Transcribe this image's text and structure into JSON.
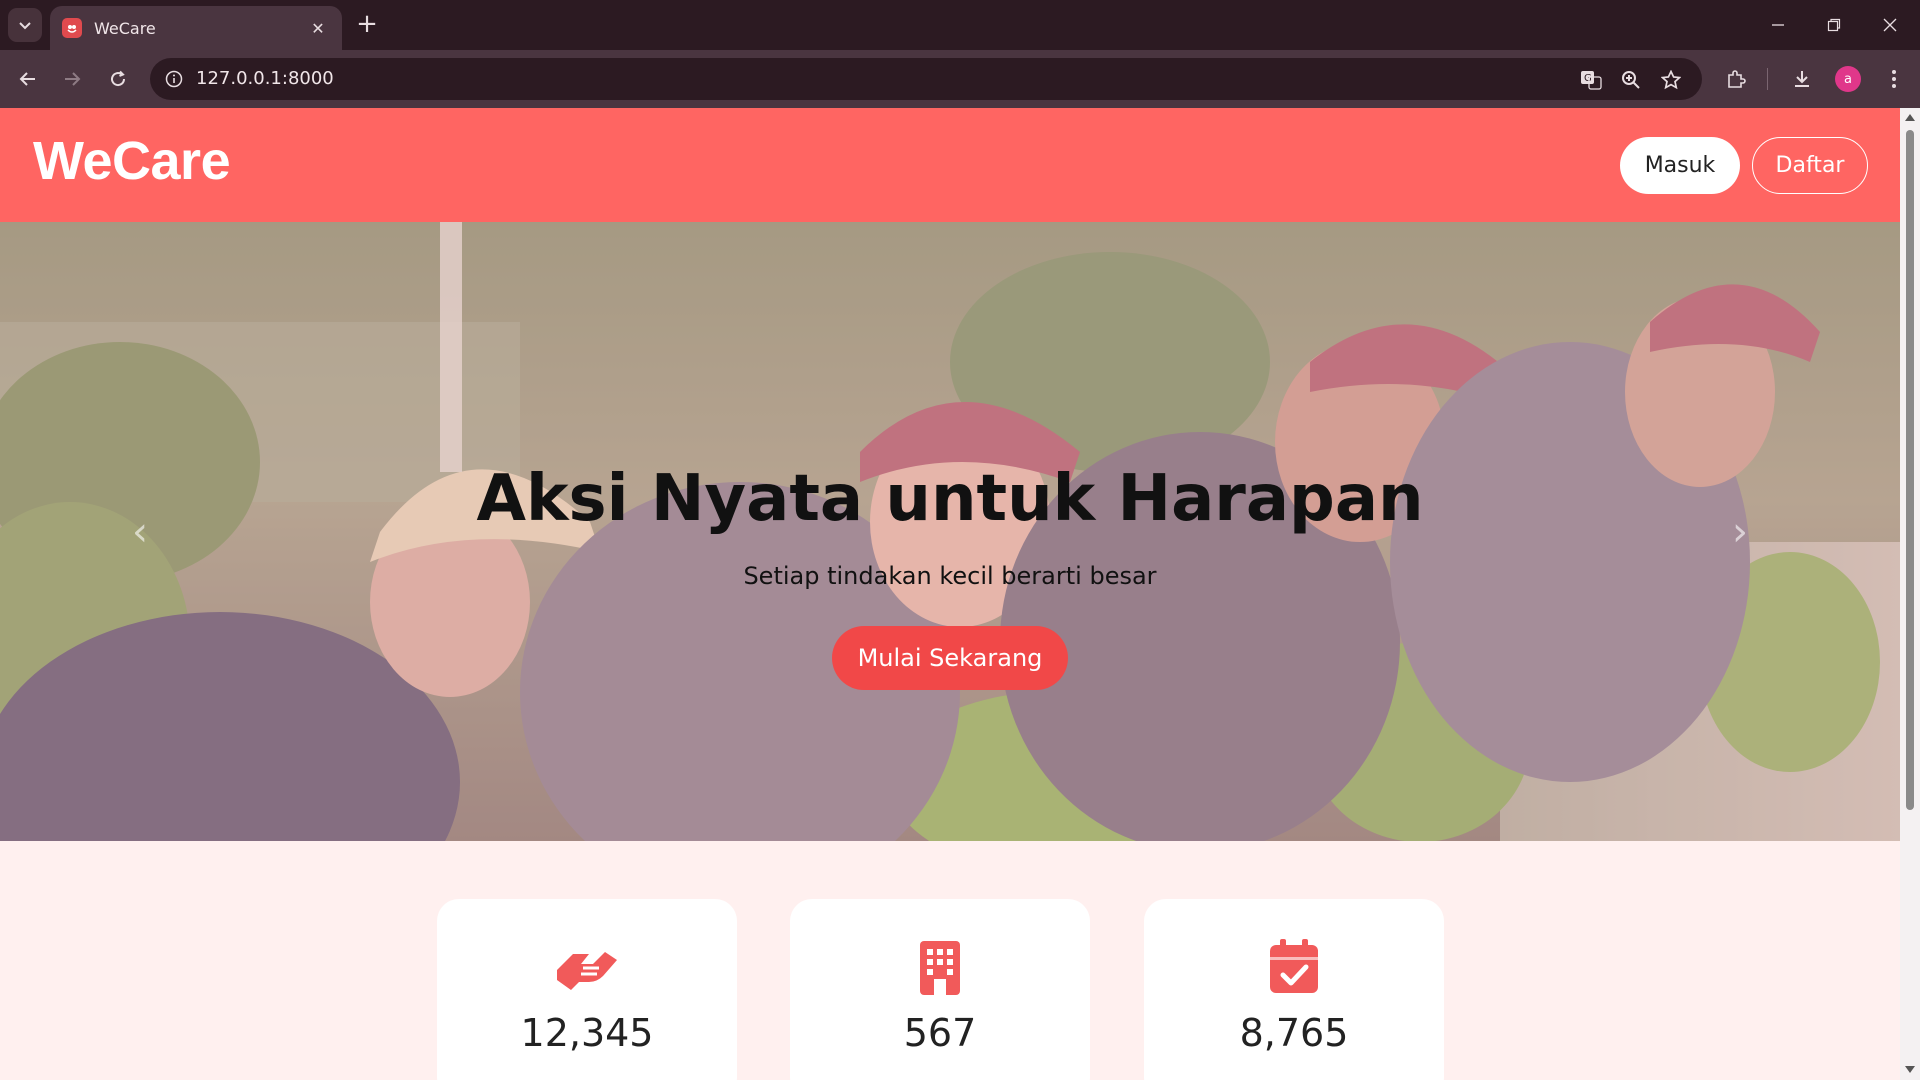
{
  "browser": {
    "tab_title": "WeCare",
    "url": "127.0.0.1:8000",
    "profile_initial": "a"
  },
  "header": {
    "logo": "WeCare",
    "login_label": "Masuk",
    "register_label": "Daftar"
  },
  "hero": {
    "title": "Aksi Nyata untuk Harapan",
    "subtitle": "Setiap tindakan kecil berarti besar",
    "cta_label": "Mulai Sekarang"
  },
  "stats": [
    {
      "icon": "handshake-icon",
      "value": "12,345"
    },
    {
      "icon": "building-icon",
      "value": "567"
    },
    {
      "icon": "calendar-check-icon",
      "value": "8,765"
    }
  ],
  "colors": {
    "brand": "#ff6562",
    "cta": "#f14848",
    "page_bg": "#fff0ef",
    "icon": "#f15a5a"
  }
}
